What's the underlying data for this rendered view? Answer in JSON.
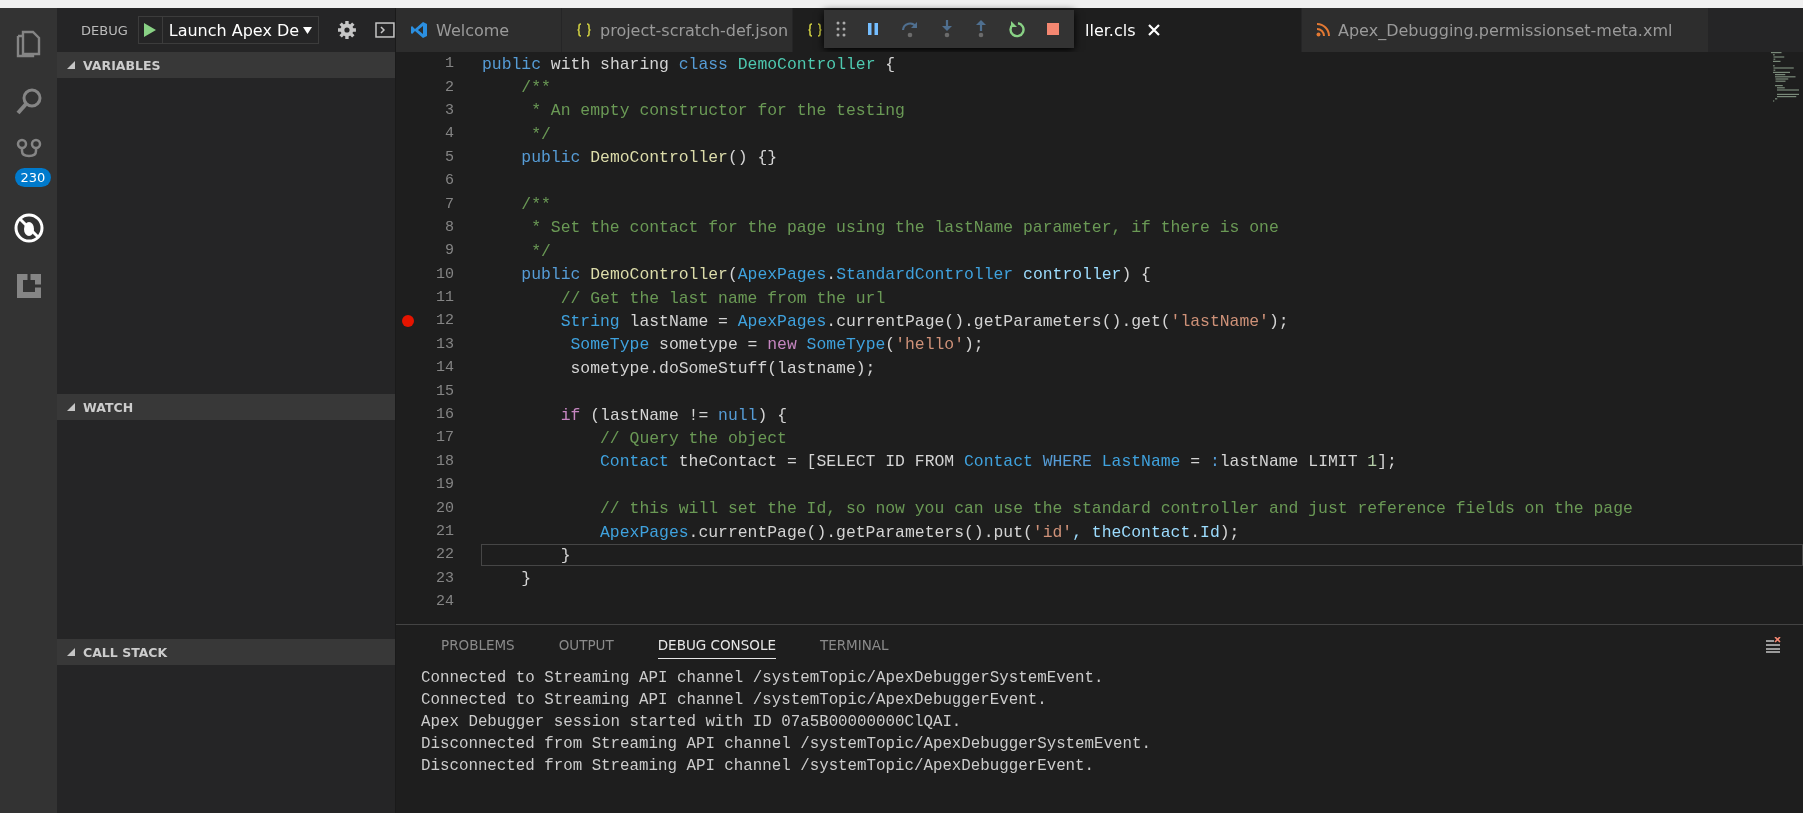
{
  "activity_bar": {
    "items": [
      {
        "kind": "files",
        "selected": false
      },
      {
        "kind": "search",
        "selected": false
      },
      {
        "kind": "scm",
        "selected": false,
        "badge": "230"
      },
      {
        "kind": "debug",
        "selected": true
      },
      {
        "kind": "extensions",
        "selected": false
      }
    ]
  },
  "debug_header": {
    "title": "DEBUG",
    "configuration": "Launch Apex De"
  },
  "sidebar": {
    "sections": [
      {
        "title": "VARIABLES",
        "expanded": true
      },
      {
        "title": "WATCH",
        "expanded": true
      },
      {
        "title": "CALL STACK",
        "expanded": true
      }
    ]
  },
  "tabs": [
    {
      "label": "Welcome",
      "kind": "vscode",
      "selected": false,
      "closable": false
    },
    {
      "label": "project-scratch-def.json",
      "kind": "json",
      "selected": false,
      "closable": false
    },
    {
      "label": "ller.cls",
      "kind": "json",
      "selected": true,
      "closable": true
    },
    {
      "label": "Apex_Debugging.permissionset-meta.xml",
      "kind": "xml",
      "selected": false,
      "closable": false
    }
  ],
  "debug_toolbar": {
    "buttons": [
      {
        "kind": "pause"
      },
      {
        "kind": "step-over"
      },
      {
        "kind": "step-into"
      },
      {
        "kind": "step-out"
      },
      {
        "kind": "restart"
      },
      {
        "kind": "stop"
      }
    ]
  },
  "editor": {
    "lines": [
      {
        "number": "1",
        "breakpoint": false,
        "current": false,
        "tokens": [
          {
            "t": "public",
            "kind": "kw"
          },
          {
            "t": " with sharing ",
            "kind": "p"
          },
          {
            "t": "class",
            "kind": "kw"
          },
          {
            "t": " DemoController",
            "kind": "type"
          },
          {
            "t": " {",
            "kind": "p"
          }
        ]
      },
      {
        "number": "2",
        "breakpoint": false,
        "current": false,
        "tokens": [
          {
            "t": "    /**",
            "kind": "cm"
          }
        ]
      },
      {
        "number": "3",
        "breakpoint": false,
        "current": false,
        "tokens": [
          {
            "t": "     * An empty constructor for the testing",
            "kind": "cm"
          }
        ]
      },
      {
        "number": "4",
        "breakpoint": false,
        "current": false,
        "tokens": [
          {
            "t": "     */",
            "kind": "cm"
          }
        ]
      },
      {
        "number": "5",
        "breakpoint": false,
        "current": false,
        "tokens": [
          {
            "t": "    public",
            "kind": "kw"
          },
          {
            "t": " DemoController",
            "kind": "fn"
          },
          {
            "t": "() {}",
            "kind": "p"
          }
        ]
      },
      {
        "number": "6",
        "breakpoint": false,
        "current": false
      },
      {
        "number": "7",
        "breakpoint": false,
        "current": false,
        "tokens": [
          {
            "t": "    /**",
            "kind": "cm"
          }
        ]
      },
      {
        "number": "8",
        "breakpoint": false,
        "current": false,
        "tokens": [
          {
            "t": "     * Set the contact for the page using the lastName parameter, if there is one",
            "kind": "cm"
          }
        ]
      },
      {
        "number": "9",
        "breakpoint": false,
        "current": false,
        "tokens": [
          {
            "t": "     */",
            "kind": "cm"
          }
        ]
      },
      {
        "number": "10",
        "breakpoint": false,
        "current": false,
        "tokens": [
          {
            "t": "    public",
            "kind": "kw"
          },
          {
            "t": " DemoController",
            "kind": "fn"
          },
          {
            "t": "(",
            "kind": "p"
          },
          {
            "t": "ApexPages",
            "kind": "cls"
          },
          {
            "t": ".",
            "kind": "p"
          },
          {
            "t": "StandardController",
            "kind": "cls"
          },
          {
            "t": " controller",
            "kind": "var"
          },
          {
            "t": ") {",
            "kind": "p"
          }
        ]
      },
      {
        "number": "11",
        "breakpoint": false,
        "current": false,
        "tokens": [
          {
            "t": "        // Get the last name from the url",
            "kind": "cm"
          }
        ]
      },
      {
        "number": "12",
        "breakpoint": true,
        "current": false,
        "tokens": [
          {
            "t": "        String",
            "kind": "cls"
          },
          {
            "t": " lastName = ",
            "kind": "p"
          },
          {
            "t": "ApexPages",
            "kind": "cls"
          },
          {
            "t": ".currentPage().getParameters().get(",
            "kind": "p"
          },
          {
            "t": "'lastName'",
            "kind": "str"
          },
          {
            "t": ");",
            "kind": "p"
          }
        ]
      },
      {
        "number": "13",
        "breakpoint": false,
        "current": false,
        "tokens": [
          {
            "t": "         SomeType",
            "kind": "cls"
          },
          {
            "t": " sometype = ",
            "kind": "p"
          },
          {
            "t": "new",
            "kind": "ctl"
          },
          {
            "t": " SomeType",
            "kind": "cls"
          },
          {
            "t": "(",
            "kind": "p"
          },
          {
            "t": "'hello'",
            "kind": "str"
          },
          {
            "t": ");",
            "kind": "p"
          }
        ]
      },
      {
        "number": "14",
        "breakpoint": false,
        "current": false,
        "tokens": [
          {
            "t": "         sometype.doSomeStuff(lastname);",
            "kind": "p"
          }
        ]
      },
      {
        "number": "15",
        "breakpoint": false,
        "current": false
      },
      {
        "number": "16",
        "breakpoint": false,
        "current": false,
        "tokens": [
          {
            "t": "        if",
            "kind": "ctl"
          },
          {
            "t": " (lastName != ",
            "kind": "p"
          },
          {
            "t": "null",
            "kind": "kw"
          },
          {
            "t": ") {",
            "kind": "p"
          }
        ]
      },
      {
        "number": "17",
        "breakpoint": false,
        "current": false,
        "tokens": [
          {
            "t": "            // Query the object",
            "kind": "cm"
          }
        ]
      },
      {
        "number": "18",
        "breakpoint": false,
        "current": false,
        "tokens": [
          {
            "t": "            Contact",
            "kind": "cls"
          },
          {
            "t": " theContact = [SELECT ID FROM ",
            "kind": "p"
          },
          {
            "t": "Contact",
            "kind": "cls"
          },
          {
            "t": " WHERE",
            "kind": "kw"
          },
          {
            "t": " LastName",
            "kind": "cls"
          },
          {
            "t": " = ",
            "kind": "p"
          },
          {
            "t": ":",
            "kind": "kw"
          },
          {
            "t": "lastName LIMIT ",
            "kind": "p"
          },
          {
            "t": "1",
            "kind": "num"
          },
          {
            "t": "];",
            "kind": "p"
          }
        ]
      },
      {
        "number": "19",
        "breakpoint": false,
        "current": false
      },
      {
        "number": "20",
        "breakpoint": false,
        "current": false,
        "tokens": [
          {
            "t": "            // this will set the Id, so now you can use the standard controller and just reference fields on the page",
            "kind": "cm"
          }
        ]
      },
      {
        "number": "21",
        "breakpoint": false,
        "current": false,
        "tokens": [
          {
            "t": "            ApexPages",
            "kind": "cls"
          },
          {
            "t": ".currentPage().getParameters().put(",
            "kind": "p"
          },
          {
            "t": "'id'",
            "kind": "str"
          },
          {
            "t": ", theContact",
            "kind": "var"
          },
          {
            "t": ".",
            "kind": "p"
          },
          {
            "t": "Id",
            "kind": "var"
          },
          {
            "t": ");",
            "kind": "p"
          }
        ]
      },
      {
        "number": "22",
        "breakpoint": false,
        "current": true,
        "tokens": [
          {
            "t": "        }",
            "kind": "p"
          }
        ]
      },
      {
        "number": "23",
        "breakpoint": false,
        "current": false,
        "tokens": [
          {
            "t": "    }",
            "kind": "p"
          }
        ]
      },
      {
        "number": "24",
        "breakpoint": false,
        "current": false
      }
    ]
  },
  "panel": {
    "tabs": [
      {
        "label": "PROBLEMS",
        "selected": false
      },
      {
        "label": "OUTPUT",
        "selected": false
      },
      {
        "label": "DEBUG CONSOLE",
        "selected": true
      },
      {
        "label": "TERMINAL",
        "selected": false
      }
    ],
    "console": [
      "Connected to Streaming API channel /systemTopic/ApexDebuggerSystemEvent.",
      "Connected to Streaming API channel /systemTopic/ApexDebuggerEvent.",
      "Apex Debugger session started with ID 07a5B00000000ClQAI.",
      "Disconnected from Streaming API channel /systemTopic/ApexDebuggerSystemEvent.",
      "Disconnected from Streaming API channel /systemTopic/ApexDebuggerEvent."
    ]
  }
}
